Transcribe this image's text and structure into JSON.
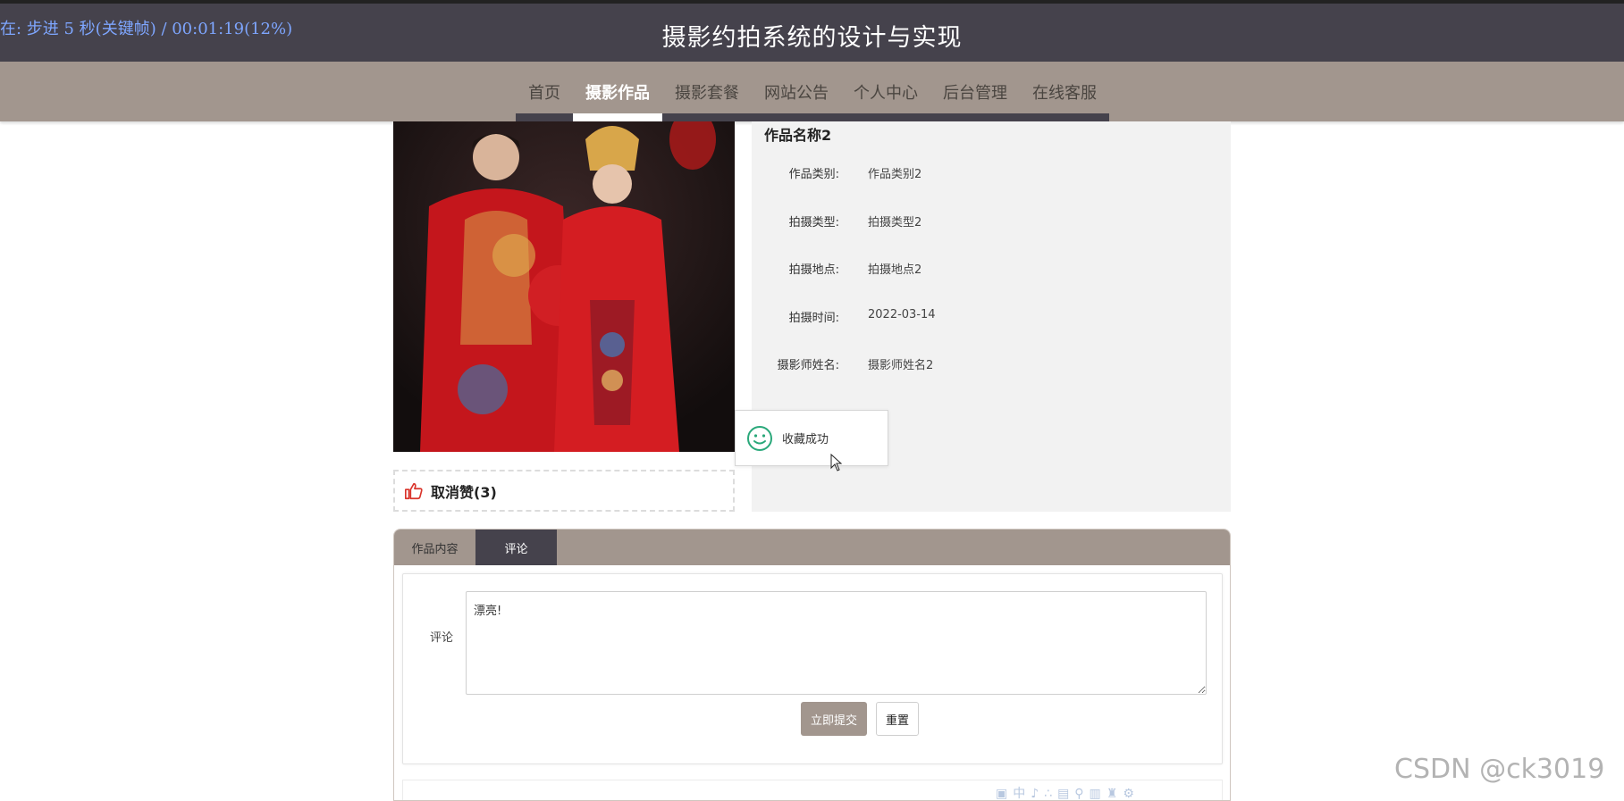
{
  "overlay_text": "在: 步进 5 秒(关键帧) / 00:01:19(12%)",
  "site_title": "摄影约拍系统的设计与实现",
  "nav": {
    "items": [
      "首页",
      "摄影作品",
      "摄影套餐",
      "网站公告",
      "个人中心",
      "后台管理",
      "在线客服"
    ],
    "active": "摄影作品"
  },
  "work": {
    "name": "作品名称2",
    "fields": [
      {
        "label": "作品类别:",
        "value": "作品类别2"
      },
      {
        "label": "拍摄类型:",
        "value": "拍摄类型2"
      },
      {
        "label": "拍摄地点:",
        "value": "拍摄地点2"
      },
      {
        "label": "拍摄时间:",
        "value": "2022-03-14"
      },
      {
        "label": "摄影师姓名:",
        "value": "摄影师姓名2"
      }
    ]
  },
  "like": {
    "label": "取消赞(3)"
  },
  "toast": {
    "message": "收藏成功"
  },
  "tabs": [
    {
      "label": "作品内容",
      "active": false
    },
    {
      "label": "评论",
      "active": true
    }
  ],
  "comment_form": {
    "label": "评论",
    "value": "漂亮!",
    "submit_label": "立即提交",
    "reset_label": "重置"
  },
  "watermark": "CSDN @ck3019",
  "colors": {
    "header": "#45424c",
    "nav": "#a2968e",
    "accent": "#a2968e",
    "toast_icon": "#2aa87a",
    "like_icon": "#d9342b"
  }
}
